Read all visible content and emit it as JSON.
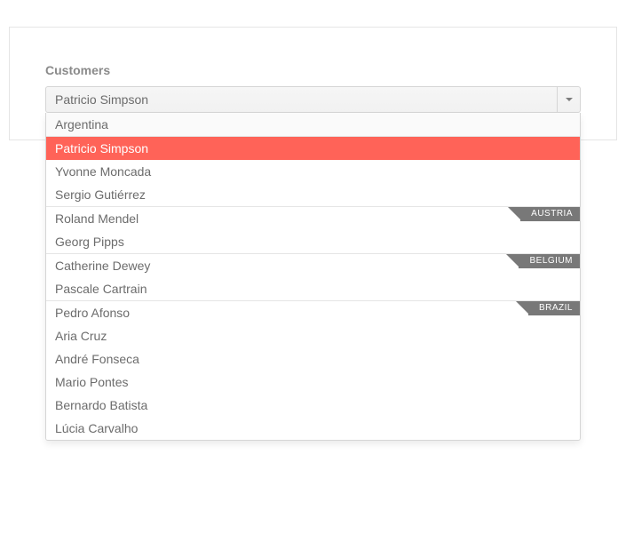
{
  "section": {
    "title": "Customers"
  },
  "combo": {
    "selected": "Patricio Simpson"
  },
  "firstGroup": {
    "name": "Argentina"
  },
  "groups": [
    {
      "name": "Argentina",
      "showNameInline": true,
      "items": [
        {
          "name": "Patricio Simpson",
          "selected": true
        },
        {
          "name": "Yvonne Moncada"
        },
        {
          "name": "Sergio Gutiérrez"
        }
      ]
    },
    {
      "name": "AUSTRIA",
      "items": [
        {
          "name": "Roland Mendel"
        },
        {
          "name": "Georg Pipps"
        }
      ]
    },
    {
      "name": "BELGIUM",
      "items": [
        {
          "name": "Catherine Dewey"
        },
        {
          "name": "Pascale Cartrain"
        }
      ]
    },
    {
      "name": "BRAZIL",
      "items": [
        {
          "name": "Pedro Afonso"
        },
        {
          "name": "Aria Cruz"
        },
        {
          "name": "André Fonseca"
        },
        {
          "name": "Mario Pontes"
        },
        {
          "name": "Bernardo Batista"
        },
        {
          "name": "Lúcia Carvalho"
        }
      ]
    }
  ],
  "colors": {
    "accent": "#ff6358"
  }
}
